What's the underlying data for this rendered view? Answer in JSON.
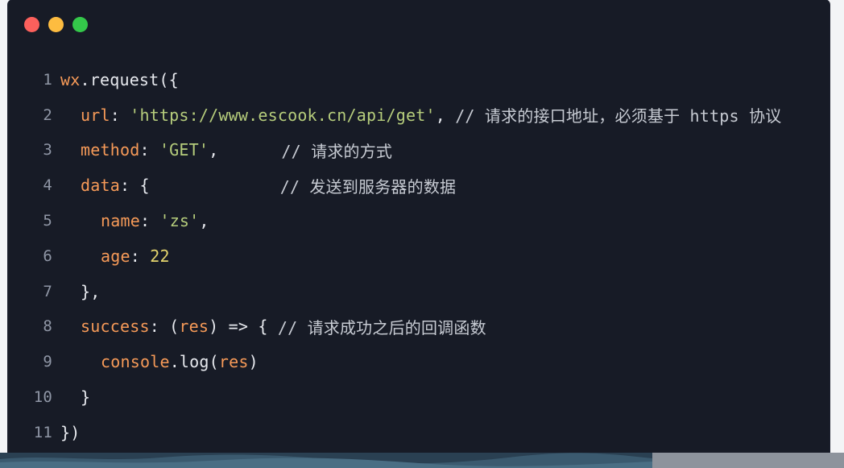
{
  "window": {
    "controls": [
      "close-dot",
      "minimize-dot",
      "maximize-dot"
    ],
    "colors": {
      "close": "#fc605c",
      "minimize": "#fdbc40",
      "maximize": "#34c84a",
      "background": "#171b26"
    }
  },
  "code": {
    "lines": [
      {
        "n": "1",
        "t1": "wx",
        "t2": ".request({"
      },
      {
        "n": "2",
        "key": "url",
        "sep": ": ",
        "str": "'https://www.escook.cn/api/get'",
        "after": ", ",
        "comment": "// 请求的接口地址，必须基于 https 协议"
      },
      {
        "n": "3",
        "key": "method",
        "sep": ": ",
        "str": "'GET'",
        "after": ",",
        "comment": "// 请求的方式"
      },
      {
        "n": "4",
        "key": "data",
        "sep": ": {",
        "comment": "// 发送到服务器的数据"
      },
      {
        "n": "5",
        "key": "name",
        "sep": ": ",
        "str": "'zs'",
        "after": ","
      },
      {
        "n": "6",
        "key": "age",
        "sep": ": ",
        "num": "22"
      },
      {
        "n": "7",
        "text": "},"
      },
      {
        "n": "8",
        "key": "success",
        "sep": ": (",
        "param": "res",
        "after": ") => { ",
        "comment": "// 请求成功之后的回调函数"
      },
      {
        "n": "9",
        "obj": "console",
        "method": ".log(",
        "param": "res",
        "after": ")"
      },
      {
        "n": "10",
        "text": "}"
      },
      {
        "n": "11",
        "text": "})"
      }
    ]
  }
}
